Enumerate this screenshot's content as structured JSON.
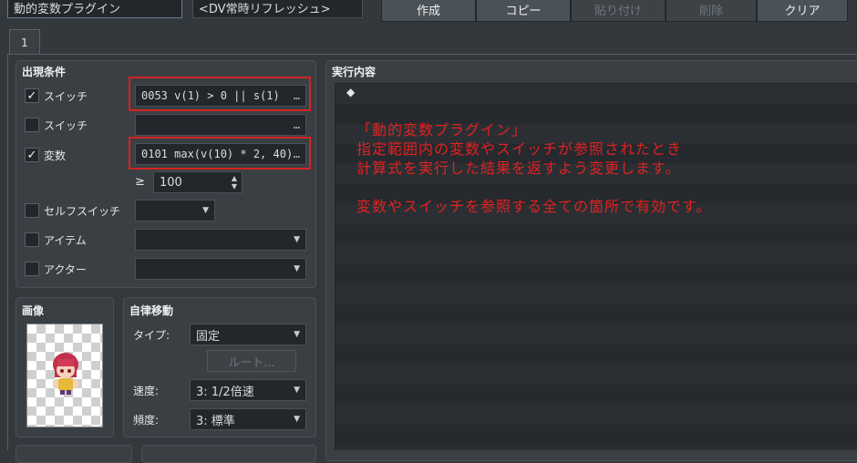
{
  "top": {
    "name_value": "動的変数プラグイン",
    "note_value": "<DV常時リフレッシュ>",
    "buttons": {
      "create": "作成",
      "copy": "コピー",
      "paste": "貼り付け",
      "delete": "削除",
      "clear": "クリア"
    }
  },
  "tab": {
    "label": "1"
  },
  "conditions": {
    "title": "出現条件",
    "switch1": {
      "label": "スイッチ",
      "checked": true,
      "value": "0053 v(1) > 0 || s(1)",
      "dots": "…"
    },
    "switch2": {
      "label": "スイッチ",
      "checked": false,
      "value": "",
      "dots": "…"
    },
    "variable": {
      "label": "変数",
      "checked": true,
      "value": "0101 max(v(10) * 2, 40)",
      "dots": "…",
      "op": "≥",
      "number": "100"
    },
    "self_switch": {
      "label": "セルフスイッチ",
      "checked": false
    },
    "item": {
      "label": "アイテム",
      "checked": false
    },
    "actor": {
      "label": "アクター",
      "checked": false
    }
  },
  "image": {
    "title": "画像"
  },
  "autonomous": {
    "title": "自律移動",
    "type_label": "タイプ:",
    "type_value": "固定",
    "route_button": "ルート...",
    "speed_label": "速度:",
    "speed_value": "3: 1/2倍速",
    "freq_label": "頻度:",
    "freq_value": "3: 標準"
  },
  "contents": {
    "title": "実行内容",
    "diamond": "◆",
    "note_lines": [
      "「動的変数プラグイン」",
      "指定範囲内の変数やスイッチが参照されたとき",
      "計算式を実行した結果を返すよう変更します。",
      "",
      "変数やスイッチを参照する全ての箇所で有効です。"
    ]
  },
  "colors": {
    "annotation": "#d32323",
    "background": "#33383d"
  },
  "icons": {
    "check": "✓",
    "spin_up": "▲",
    "spin_down": "▼",
    "caret": "▼"
  }
}
